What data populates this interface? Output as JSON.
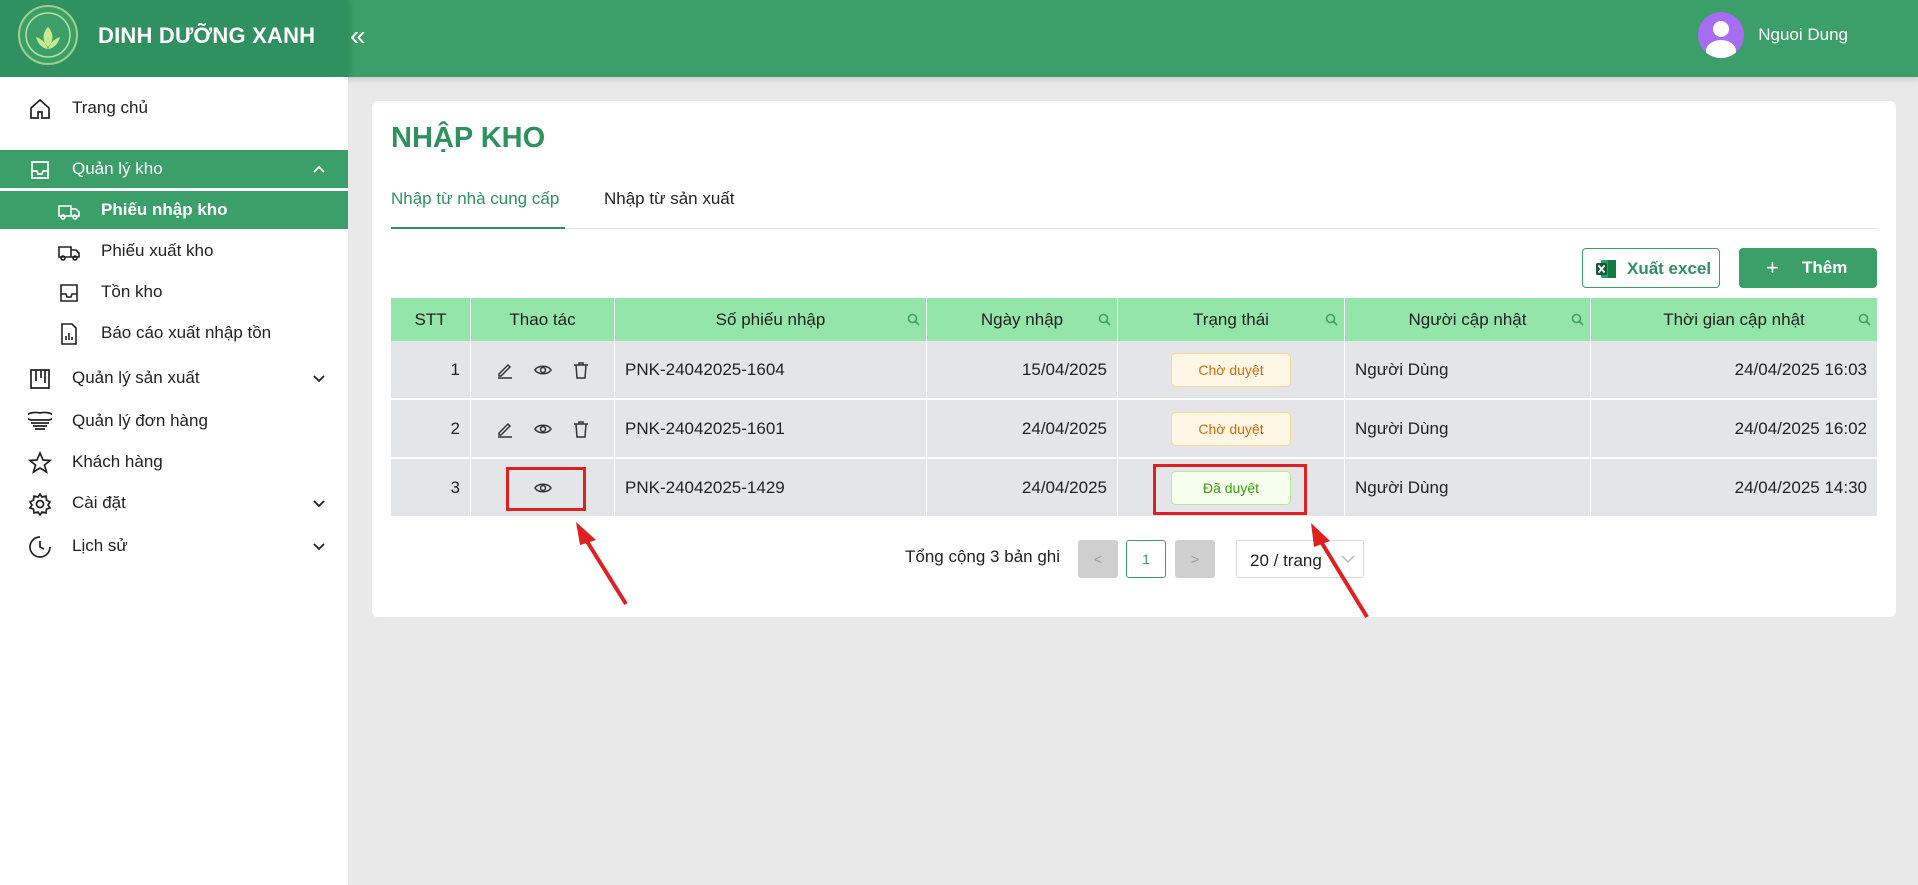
{
  "header": {
    "brand": "DINH DƯỠNG XANH",
    "collapse_icon": "«",
    "user_name": "Nguoi Dung"
  },
  "sidebar": {
    "items": [
      {
        "label": "Trang chủ",
        "icon": "home-icon"
      },
      {
        "label": "Quản lý kho",
        "icon": "inbox-icon",
        "expanded": true
      },
      {
        "label": "Phiếu nhập kho",
        "icon": "truck-in-icon",
        "sub": true,
        "active": true
      },
      {
        "label": "Phiếu xuất kho",
        "icon": "truck-out-icon",
        "sub": true
      },
      {
        "label": "Tồn kho",
        "icon": "inbox-icon",
        "sub": true
      },
      {
        "label": "Báo cáo xuất nhập tồn",
        "icon": "report-icon",
        "sub": true
      },
      {
        "label": "Quản lý sản xuất",
        "icon": "factory-icon"
      },
      {
        "label": "Quản lý đơn hàng",
        "icon": "order-icon"
      },
      {
        "label": "Khách hàng",
        "icon": "star-icon"
      },
      {
        "label": "Cài đặt",
        "icon": "gear-icon"
      },
      {
        "label": "Lịch sử",
        "icon": "history-icon"
      }
    ]
  },
  "main": {
    "title": "NHẬP KHO",
    "tabs": [
      {
        "label": "Nhập từ nhà cung cấp",
        "active": true
      },
      {
        "label": "Nhập từ sản xuất"
      }
    ],
    "toolbar": {
      "excel_label": "Xuất excel",
      "add_label": "Thêm",
      "add_icon": "+"
    },
    "table": {
      "columns": [
        "STT",
        "Thao tác",
        "Số phiếu nhập",
        "Ngày nhập",
        "Trạng thái",
        "Người cập nhật",
        "Thời gian cập nhật"
      ],
      "rows": [
        {
          "stt": "1",
          "code": "PNK-24042025-1604",
          "date": "15/04/2025",
          "status": "Chờ duyệt",
          "status_kind": "pending",
          "user": "Người Dùng",
          "updated": "24/04/2025 16:03",
          "actions": [
            "edit",
            "view",
            "delete"
          ]
        },
        {
          "stt": "2",
          "code": "PNK-24042025-1601",
          "date": "24/04/2025",
          "status": "Chờ duyệt",
          "status_kind": "pending",
          "user": "Người Dùng",
          "updated": "24/04/2025 16:02",
          "actions": [
            "edit",
            "view",
            "delete"
          ]
        },
        {
          "stt": "3",
          "code": "PNK-24042025-1429",
          "date": "24/04/2025",
          "status": "Đã duyệt",
          "status_kind": "approved",
          "user": "Người Dùng",
          "updated": "24/04/2025 14:30",
          "actions": [
            "view"
          ]
        }
      ]
    },
    "pagination": {
      "total_text": "Tổng cộng 3 bản ghi",
      "prev": "<",
      "current": "1",
      "next": ">",
      "page_size": "20 / trang"
    }
  },
  "colors": {
    "primary": "#3a9f68",
    "header_row": "#94e5aa",
    "annotation": "#e02020"
  }
}
